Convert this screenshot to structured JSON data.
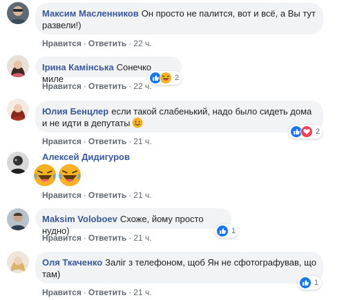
{
  "comments": [
    {
      "author": "Максим Масленников",
      "text": "Он просто не палится, вот и всё, а Вы тут развели!)",
      "actions": {
        "like": "Нравится",
        "reply": "Ответить",
        "time": "22 ч."
      }
    },
    {
      "author": "Ірина Камінська",
      "text": "Сонечко миле",
      "actions": {
        "like": "Нравится",
        "reply": "Ответить",
        "time": "22 ч."
      },
      "reactions": {
        "icons": [
          "like-icon",
          "laugh-icon"
        ],
        "count": "2"
      }
    },
    {
      "author": "Юлия Бенцлер",
      "text": "если такой слабенький, надо было сидеть дома и не идти в депутаты",
      "emoji": "smile-emoji",
      "actions": {
        "like": "Нравится",
        "reply": "Ответить",
        "time": "21 ч."
      },
      "reactions": {
        "icons": [
          "like-icon",
          "love-icon"
        ],
        "count": "2"
      }
    },
    {
      "author": "Алексей Дидигуров",
      "emoji": [
        "laugh-emoji",
        "laugh-emoji"
      ],
      "actions": {
        "like": "Нравится",
        "reply": "Ответить",
        "time": "21 ч."
      }
    },
    {
      "author": "Maksim Voloboev",
      "text": "Схоже, йому просто нудно)",
      "actions": {
        "like": "Нравится",
        "reply": "Ответить",
        "time": "21 ч."
      },
      "reactions": {
        "icons": [
          "like-icon"
        ],
        "count": "1"
      }
    },
    {
      "author": "Оля Ткаченко",
      "text": "Заліг з телефоном, щоб Ян не сфотографував, що там)",
      "actions": {
        "like": "Нравится",
        "reply": "Ответить",
        "time": "21 ч."
      },
      "reactions": {
        "icons": [
          "like-icon"
        ],
        "count": "1"
      }
    }
  ],
  "colors": {
    "bubble": "#f2f3f5",
    "author": "#385898",
    "meta": "#606770",
    "like": "#1877f2",
    "love": "#f33e58",
    "emoji": "#f7b125"
  }
}
